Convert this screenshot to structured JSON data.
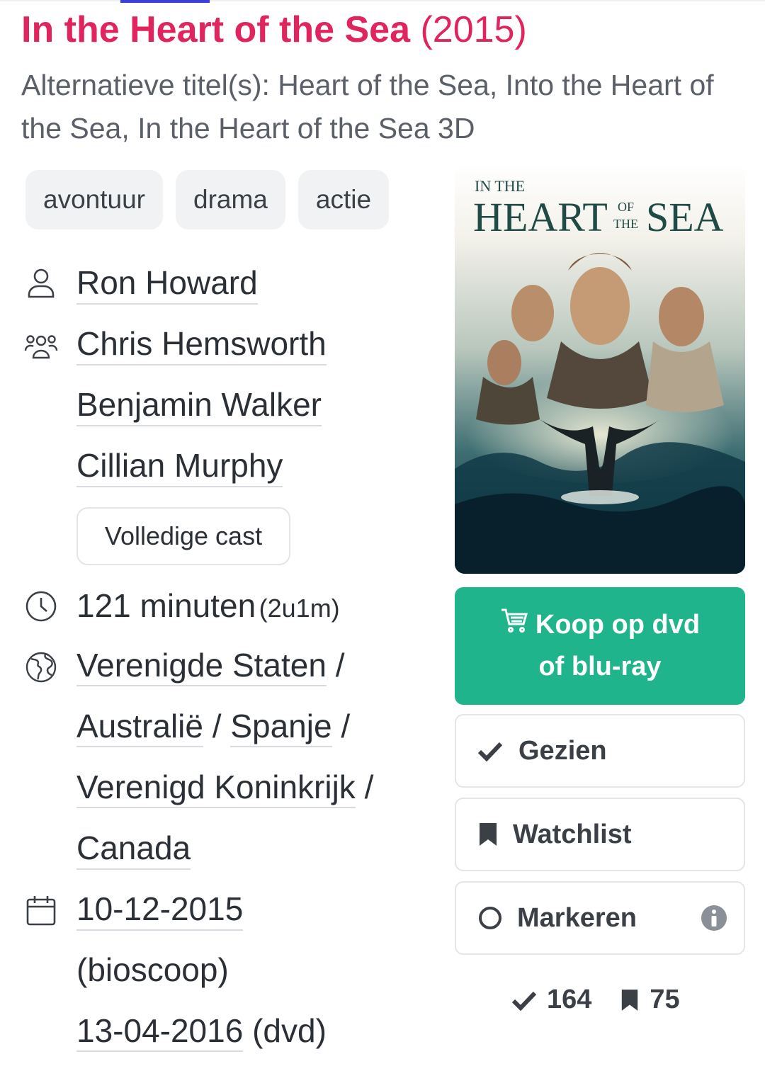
{
  "movie": {
    "title": "In the Heart of the Sea",
    "year": "(2015)",
    "alt_titles": "Alternatieve titel(s): Heart of the Sea, Into the Heart of the Sea, In the Heart of the Sea 3D"
  },
  "genres": [
    "avontuur",
    "drama",
    "actie"
  ],
  "director": "Ron Howard",
  "cast": [
    "Chris Hemsworth",
    "Benjamin Walker",
    "Cillian Murphy"
  ],
  "full_cast_label": "Volledige cast",
  "runtime": {
    "minutes": "121 minuten",
    "short": "(2u1m)"
  },
  "countries": [
    "Verenigde Staten",
    "Australië",
    "Spanje",
    "Verenigd Koninkrijk",
    "Canada"
  ],
  "country_separator": "/",
  "release": {
    "cinema_date": "10-12-2015",
    "cinema_label": "(bioscoop)",
    "dvd_date": "13-04-2016",
    "dvd_label": "(dvd)"
  },
  "poster": {
    "line1": "IN THE",
    "line2a": "HEART",
    "line2b_top": "OF",
    "line2b_bot": "THE",
    "line2c": "SEA"
  },
  "actions": {
    "buy_line1": "Koop op dvd",
    "buy_line2": "of blu-ray",
    "seen": "Gezien",
    "watchlist": "Watchlist",
    "mark": "Markeren"
  },
  "stats": {
    "seen_count": "164",
    "watchlist_count": "75"
  },
  "colors": {
    "title": "#e0245e",
    "buy_button": "#1fb48c",
    "accent_bar": "#3b3fd8"
  },
  "icons": [
    "person-icon",
    "group-icon",
    "clock-icon",
    "globe-icon",
    "calendar-icon",
    "cart-icon",
    "check-icon",
    "bookmark-icon",
    "circle-icon",
    "info-icon"
  ]
}
